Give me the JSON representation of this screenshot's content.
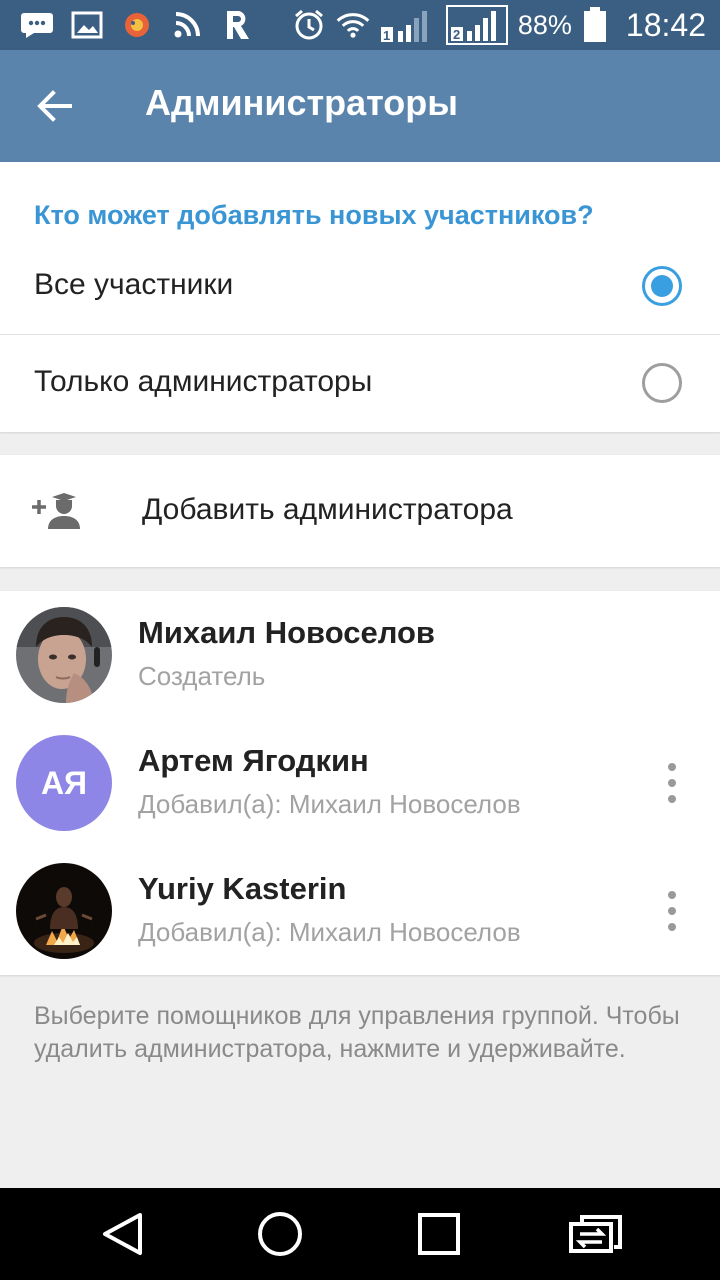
{
  "status_bar": {
    "left_icons": [
      "chat-icon",
      "image-icon",
      "app-icon",
      "rss-icon",
      "r-app-icon"
    ],
    "right_icons": [
      "alarm-icon",
      "wifi-icon",
      "signal-sim1-icon",
      "signal-sim2-icon",
      "battery-icon"
    ],
    "battery": "88%",
    "time": "18:42"
  },
  "appbar": {
    "title": "Администраторы",
    "back_icon": "arrow-back-icon",
    "color": "#5a84ab"
  },
  "who_can_add": {
    "header": "Кто может добавлять новых участников?",
    "options": [
      {
        "label": "Все участники",
        "selected": true
      },
      {
        "label": "Только администраторы",
        "selected": false
      }
    ]
  },
  "add_admin": {
    "label": "Добавить администратора",
    "icon": "add-admin-icon"
  },
  "admins": [
    {
      "name": "Михаил Новоселов",
      "subtitle": "Создатель",
      "avatar": "photo",
      "has_menu": false
    },
    {
      "name": "Артем Ягодкин",
      "subtitle": "Добавил(а): Михаил Новоселов",
      "avatar_initials": "АЯ",
      "avatar_color": "#8e86e6",
      "has_menu": true
    },
    {
      "name": "Yuriy Kasterin",
      "subtitle": "Добавил(а): Михаил Новоселов",
      "avatar": "photo",
      "has_menu": true
    }
  ],
  "hint": "Выберите помощников для управления группой. Чтобы удалить администратора, нажмите и удерживайте.",
  "nav_bar": [
    "back-triangle-icon",
    "home-circle-icon",
    "recents-square-icon",
    "dual-window-icon"
  ],
  "colors": {
    "accent": "#3a95d5",
    "radio_active": "#3a9fe0",
    "status_bar": "#3b5f82"
  }
}
